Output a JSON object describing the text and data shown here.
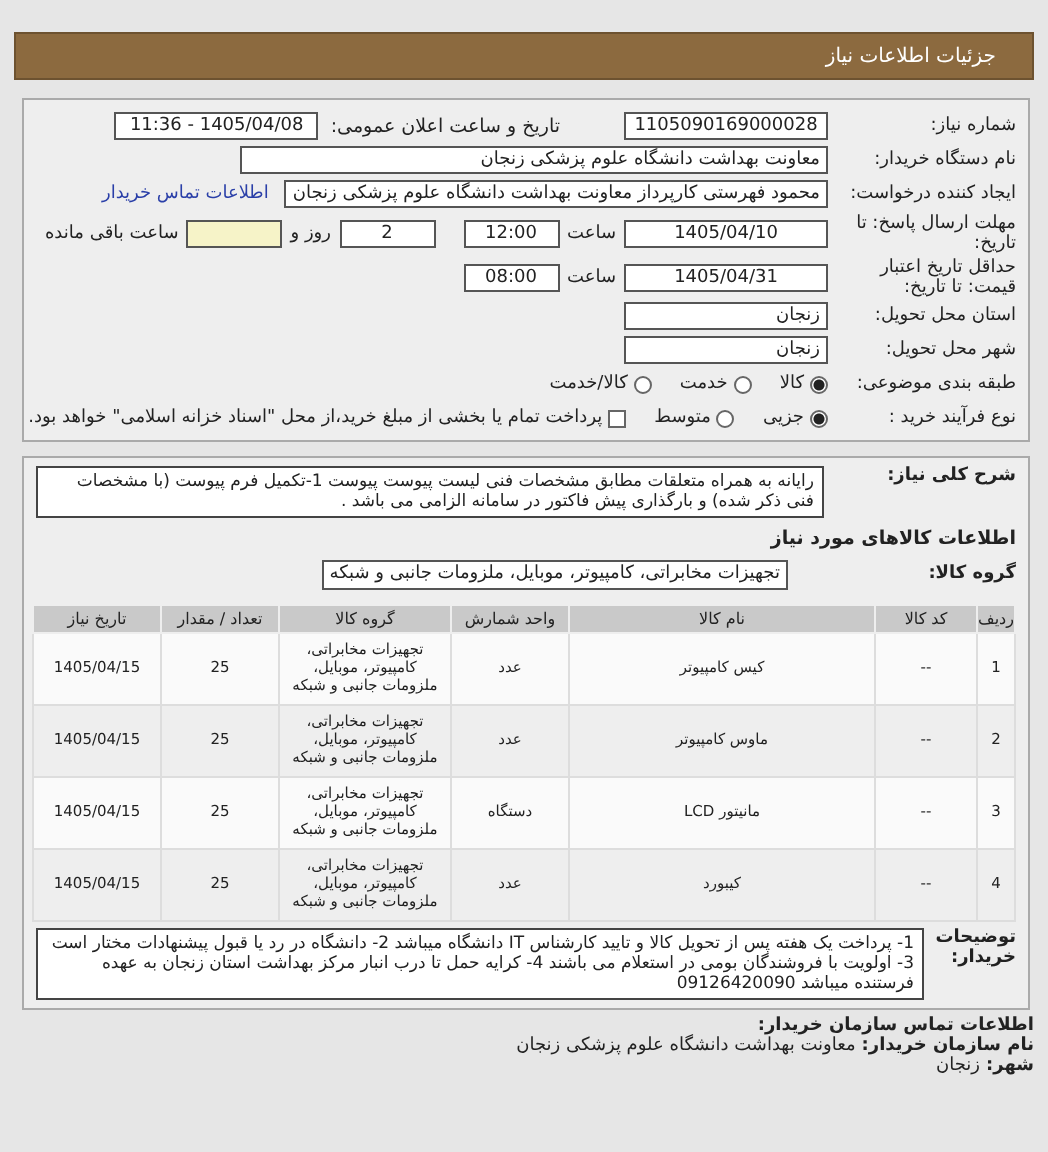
{
  "header": {
    "title": "جزئیات اطلاعات نیاز"
  },
  "need_number": {
    "label": "شماره نیاز:",
    "value": "1105090169000028"
  },
  "announce": {
    "label": "تاریخ و ساعت اعلان عمومی:",
    "value": "1405/04/08 - 11:36"
  },
  "buyer_org": {
    "label": "نام دستگاه خریدار:",
    "value": "معاونت بهداشت دانشگاه علوم پزشکی زنجان"
  },
  "requester": {
    "label": "ایجاد کننده درخواست:",
    "value": "محمود فهرستی کارپرداز معاونت بهداشت دانشگاه علوم پزشکی زنجان",
    "link": "اطلاعات تماس خریدار"
  },
  "deadline": {
    "label": "مهلت ارسال پاسخ: تا تاریخ:",
    "date": "1405/04/10",
    "time_label": "ساعت",
    "time": "12:00",
    "days": "2",
    "days_label": "روز و",
    "hours_label": "ساعت باقی مانده"
  },
  "validity": {
    "label": "حداقل تاریخ اعتبار قیمت: تا تاریخ:",
    "date": "1405/04/31",
    "time_label": "ساعت",
    "time": "08:00"
  },
  "province": {
    "label": "استان محل تحویل:",
    "value": "زنجان"
  },
  "city": {
    "label": "شهر محل تحویل:",
    "value": "زنجان"
  },
  "category": {
    "label": "طبقه بندی موضوعی:",
    "options": [
      {
        "label": "کالا",
        "selected": true
      },
      {
        "label": "خدمت",
        "selected": false
      },
      {
        "label": "کالا/خدمت",
        "selected": false
      }
    ]
  },
  "process": {
    "label": "نوع فرآیند خرید :",
    "options": [
      {
        "label": "جزیی",
        "selected": true
      },
      {
        "label": "متوسط",
        "selected": false
      }
    ],
    "treasury": {
      "label": "پرداخت تمام یا بخشی از مبلغ خرید،از محل \"اسناد خزانه اسلامی\" خواهد بود.",
      "checked": false
    }
  },
  "description": {
    "label": "شرح کلی نیاز:",
    "text": "رایانه به همراه متعلقات مطابق مشخصات فنی لیست پیوست پیوست 1-تکمیل فرم پیوست (با مشخصات فنی ذکر شده) و بارگذاری پیش فاکتور در سامانه الزامی می باشد ."
  },
  "goods_title": "اطلاعات کالاهای مورد نیاز",
  "goods_group": {
    "label": "گروه کالا:",
    "value": "تجهیزات مخابراتی، کامپیوتر، موبایل، ملزومات جانبی و شبکه"
  },
  "table": {
    "columns": [
      "ردیف",
      "کد کالا",
      "نام کالا",
      "واحد شمارش",
      "گروه کالا",
      "تعداد / مقدار",
      "تاریخ نیاز"
    ],
    "rows": [
      [
        "1",
        "--",
        "کیس کامپیوتر",
        "عدد",
        "تجهیزات مخابراتی، کامپیوتر، موبایل، ملزومات جانبی و شبکه",
        "25",
        "1405/04/15"
      ],
      [
        "2",
        "--",
        "ماوس کامپیوتر",
        "عدد",
        "تجهیزات مخابراتی، کامپیوتر، موبایل، ملزومات جانبی و شبکه",
        "25",
        "1405/04/15"
      ],
      [
        "3",
        "--",
        "مانیتور LCD",
        "دستگاه",
        "تجهیزات مخابراتی، کامپیوتر، موبایل، ملزومات جانبی و شبکه",
        "25",
        "1405/04/15"
      ],
      [
        "4",
        "--",
        "کیبورد",
        "عدد",
        "تجهیزات مخابراتی، کامپیوتر، موبایل، ملزومات جانبی و شبکه",
        "25",
        "1405/04/15"
      ]
    ]
  },
  "buyer_notes": {
    "label": "توضیحات خریدار:",
    "text": "1- پرداخت یک هفته پس از تحویل کالا و تایید کارشناس IT دانشگاه میباشد 2- دانشگاه در رد یا قبول پیشنهادات مختار است 3- اولویت با فروشندگان بومی در استعلام می باشند 4- کرایه حمل تا درب انبار مرکز بهداشت استان زنجان به عهده فرستنده میباشد 09126420090"
  },
  "contact": {
    "title": "اطلاعات تماس سازمان خریدار:",
    "fields": [
      {
        "label": "نام سازمان خریدار:",
        "value": "معاونت بهداشت دانشگاه علوم پزشکی زنجان"
      },
      {
        "label": "شهر:",
        "value": "زنجان"
      }
    ]
  }
}
